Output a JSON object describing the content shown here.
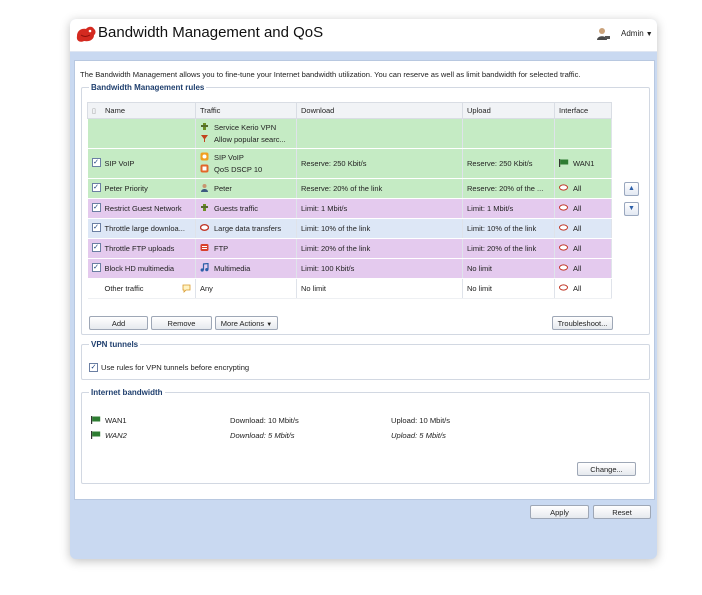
{
  "app": {
    "title": "Bandwidth Management and QoS",
    "user": "Admin",
    "colors": {
      "accent": "#1f3f6e",
      "frame": "#c9d9f1",
      "row_green": "#c5ebc4",
      "row_purple": "#e4caee",
      "row_blue": "#dde7f6"
    }
  },
  "intro": "The Bandwidth Management allows you to fine-tune your Internet bandwidth utilization. You can reserve as well as limit bandwidth for selected traffic.",
  "rules": {
    "legend": "Bandwidth Management rules",
    "columns": [
      "Name",
      "Traffic",
      "Download",
      "Upload",
      "Interface"
    ],
    "rows": [
      {
        "name": "",
        "traffic": [
          "Service Kerio VPN",
          "Allow popular searc..."
        ],
        "download": "",
        "upload": "",
        "interface": ""
      },
      {
        "name": "SIP VoIP",
        "traffic": [
          "SIP VoIP",
          "QoS DSCP 10"
        ],
        "download": "Reserve: 250 Kbit/s",
        "upload": "Reserve: 250 Kbit/s",
        "interface": "WAN1"
      },
      {
        "name": "Peter Priority",
        "traffic": [
          "Peter"
        ],
        "download": "Reserve: 20% of the link",
        "upload": "Reserve: 20% of the ...",
        "interface": "All"
      },
      {
        "name": "Restrict Guest Network",
        "traffic": [
          "Guests traffic"
        ],
        "download": "Limit: 1 Mbit/s",
        "upload": "Limit: 1 Mbit/s",
        "interface": "All"
      },
      {
        "name": "Throttle large downloa...",
        "traffic": [
          "Large data transfers"
        ],
        "download": "Limit: 10% of the link",
        "upload": "Limit: 10% of the link",
        "interface": "All"
      },
      {
        "name": "Throttle FTP uploads",
        "traffic": [
          "FTP"
        ],
        "download": "Limit: 20% of the link",
        "upload": "Limit: 20% of the link",
        "interface": "All"
      },
      {
        "name": "Block HD multimedia",
        "traffic": [
          "Multimedia"
        ],
        "download": "Limit: 100 Kbit/s",
        "upload": "No limit",
        "interface": "All"
      },
      {
        "name": "Other traffic",
        "traffic": [
          "Any"
        ],
        "download": "No limit",
        "upload": "No limit",
        "interface": "All"
      }
    ],
    "buttons": {
      "add": "Add",
      "remove": "Remove",
      "more": "More Actions",
      "troubleshoot": "Troubleshoot..."
    }
  },
  "vpn": {
    "legend": "VPN tunnels",
    "checkbox_label": "Use rules for VPN tunnels before encrypting"
  },
  "bandwidth": {
    "legend": "Internet bandwidth",
    "links": [
      {
        "name": "WAN1",
        "download": "Download: 10 Mbit/s",
        "upload": "Upload: 10 Mbit/s"
      },
      {
        "name": "WAN2",
        "download": "Download: 5 Mbit/s",
        "upload": "Upload: 5 Mbit/s"
      }
    ],
    "change": "Change..."
  },
  "footer": {
    "apply": "Apply",
    "reset": "Reset"
  }
}
